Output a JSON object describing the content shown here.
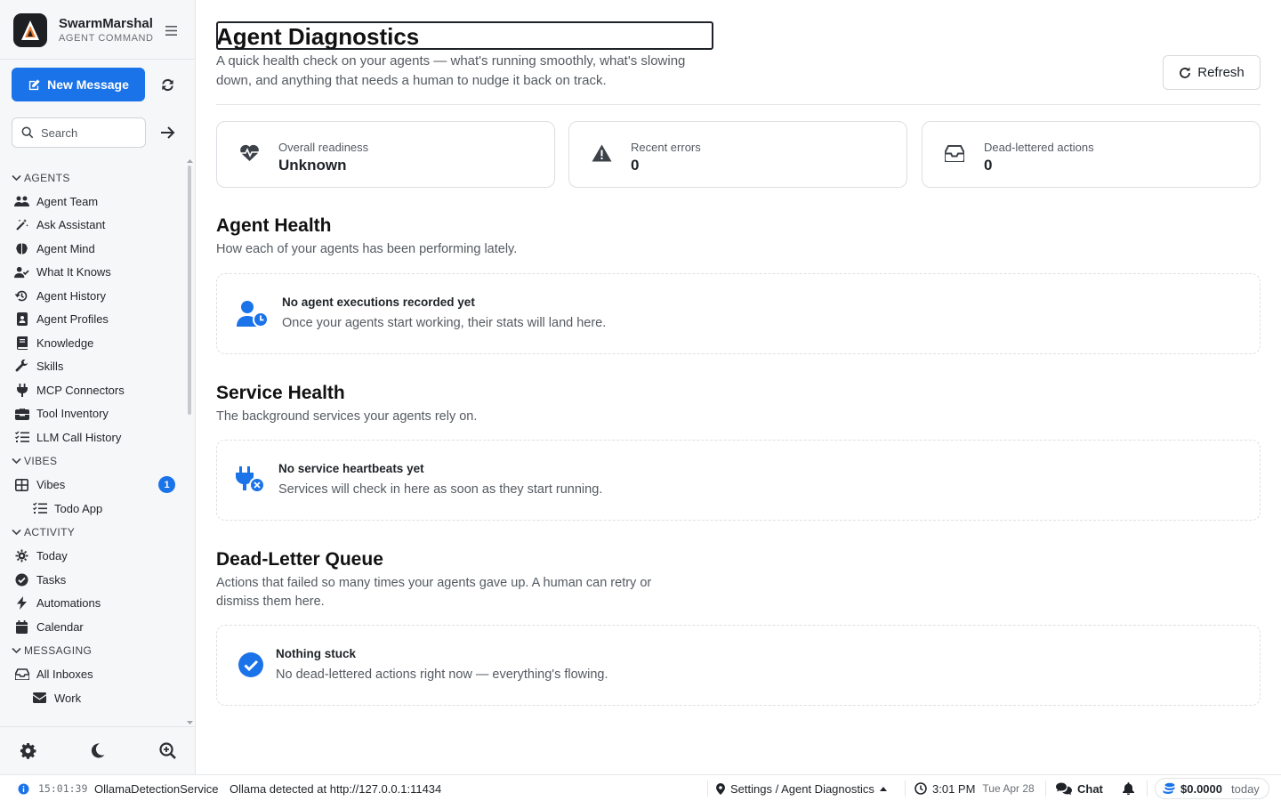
{
  "app": {
    "name": "SwarmMarshal",
    "subtitle": "AGENT COMMAND"
  },
  "sidebar": {
    "new_message_label": "New Message",
    "search_placeholder": "Search",
    "sections": {
      "agents": "AGENTS",
      "vibes": "VIBES",
      "activity": "ACTIVITY",
      "messaging": "MESSAGING"
    },
    "agents_items": [
      "Agent Team",
      "Ask Assistant",
      "Agent Mind",
      "What It Knows",
      "Agent History",
      "Agent Profiles",
      "Knowledge",
      "Skills",
      "MCP Connectors",
      "Tool Inventory",
      "LLM Call History"
    ],
    "vibes_items": {
      "vibes": "Vibes",
      "vibes_badge": "1",
      "todo_app": "Todo App"
    },
    "activity_items": [
      "Today",
      "Tasks",
      "Automations",
      "Calendar"
    ],
    "messaging_items": {
      "all_inboxes": "All Inboxes",
      "work": "Work"
    }
  },
  "page": {
    "title": "Agent Diagnostics",
    "description": "A quick health check on your agents — what's running smoothly, what's slowing down, and anything that needs a human to nudge it back on track.",
    "refresh_label": "Refresh"
  },
  "stats": [
    {
      "label": "Overall readiness",
      "value": "Unknown",
      "icon": "heartbeat-icon"
    },
    {
      "label": "Recent errors",
      "value": "0",
      "icon": "warning-icon"
    },
    {
      "label": "Dead-lettered actions",
      "value": "0",
      "icon": "inbox-icon"
    }
  ],
  "sections": {
    "agent_health": {
      "title": "Agent Health",
      "description": "How each of your agents has been performing lately.",
      "empty_title": "No agent executions recorded yet",
      "empty_desc": "Once your agents start working, their stats will land here."
    },
    "service_health": {
      "title": "Service Health",
      "description": "The background services your agents rely on.",
      "empty_title": "No service heartbeats yet",
      "empty_desc": "Services will check in here as soon as they start running."
    },
    "dead_letter": {
      "title": "Dead-Letter Queue",
      "description": "Actions that failed so many times your agents gave up. A human can retry or dismiss them here.",
      "empty_title": "Nothing stuck",
      "empty_desc": "No dead-lettered actions right now — everything's flowing."
    }
  },
  "statusbar": {
    "log_time": "15:01:39",
    "log_source": "OllamaDetectionService",
    "log_message": "Ollama detected at http://127.0.0.1:11434",
    "location": "Settings / Agent Diagnostics",
    "clock_time": "3:01 PM",
    "clock_date": "Tue Apr 28",
    "chat_label": "Chat",
    "cost": "$0.0000",
    "cost_period": "today"
  },
  "colors": {
    "accent": "#1a73e8",
    "text": "#1f2328",
    "muted": "#555a61",
    "sidebar_bg": "#f6f7f8"
  }
}
